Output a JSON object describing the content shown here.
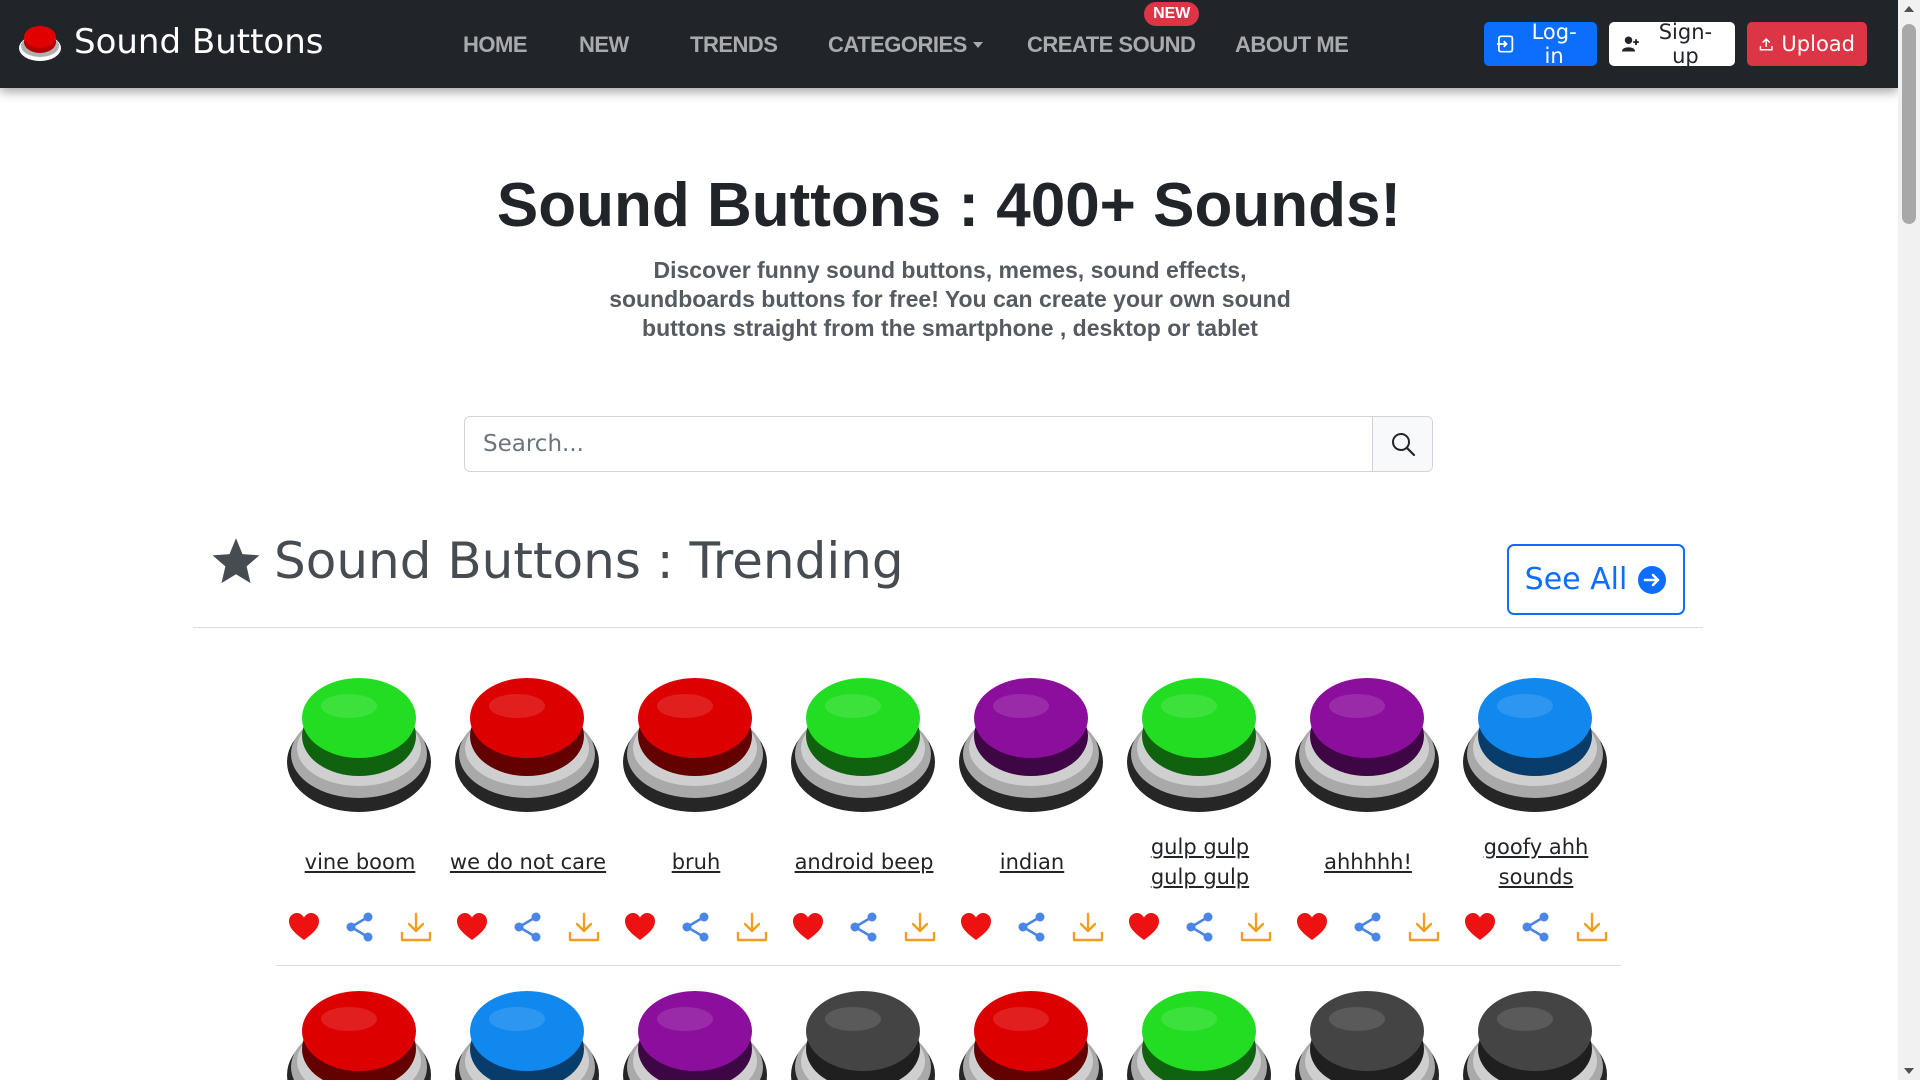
{
  "nav": {
    "brand": "Sound Buttons",
    "links": [
      {
        "label": "HOME"
      },
      {
        "label": "NEW"
      },
      {
        "label": "TRENDS"
      },
      {
        "label": "CATEGORIES"
      },
      {
        "label": "CREATE SOUND",
        "badge": "NEW"
      },
      {
        "label": "ABOUT ME"
      }
    ],
    "login": "Log-in",
    "signup": "Sign-up",
    "upload": "Upload"
  },
  "hero": {
    "title": "Sound Buttons : 400+ Sounds!",
    "subtitle": "Discover funny sound buttons, memes, sound effects, soundboards buttons for free! You can create your own sound buttons straight from the smartphone , desktop or tablet"
  },
  "search": {
    "placeholder": "Search..."
  },
  "section": {
    "title": "Sound Buttons : Trending",
    "see_all": "See All"
  },
  "colors": {
    "green": "#22dd22",
    "red": "#dd0000",
    "purple": "#8c0e9c",
    "blue": "#1188ee",
    "dark": "#444444",
    "heart": "#ee1111",
    "share": "#4a86e8",
    "download": "#f0a020"
  },
  "sounds": [
    {
      "name": "vine boom",
      "color": "green"
    },
    {
      "name": "we do not care",
      "color": "red"
    },
    {
      "name": "bruh",
      "color": "red"
    },
    {
      "name": "android beep",
      "color": "green"
    },
    {
      "name": "indian",
      "color": "purple"
    },
    {
      "name": "gulp gulp gulp gulp",
      "color": "green"
    },
    {
      "name": "ahhhhh!",
      "color": "purple"
    },
    {
      "name": "goofy ahh sounds",
      "color": "blue"
    }
  ],
  "sounds_row2": [
    {
      "color": "red"
    },
    {
      "color": "blue"
    },
    {
      "color": "purple"
    },
    {
      "color": "dark"
    },
    {
      "color": "red"
    },
    {
      "color": "green"
    },
    {
      "color": "dark"
    },
    {
      "color": "dark"
    }
  ],
  "actions": {
    "heart": "heart-icon",
    "share": "share-icon",
    "download": "download-icon"
  }
}
